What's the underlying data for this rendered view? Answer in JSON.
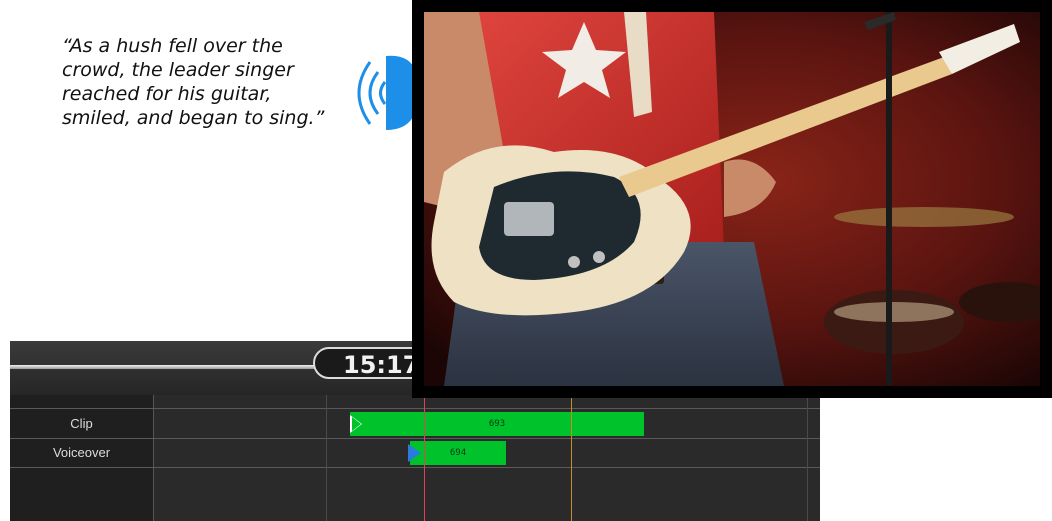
{
  "quote": {
    "lines": [
      "“As a hush fell over the",
      "crowd, the leader singer",
      "reached for his guitar,",
      "smiled, and began to sing.”"
    ]
  },
  "timeline": {
    "timecode": "15:17",
    "tracks": [
      {
        "label": "Clip",
        "clip_label": "693",
        "marker_color": "#00c22b"
      },
      {
        "label": "Voiceover",
        "clip_label": "694",
        "marker_color": "#2b7bdc"
      }
    ]
  },
  "colors": {
    "speaker": "#1e8fe8",
    "clip_green": "#00c22b",
    "playhead_red": "#e0405a",
    "playhead_orange": "#c98a2a"
  }
}
